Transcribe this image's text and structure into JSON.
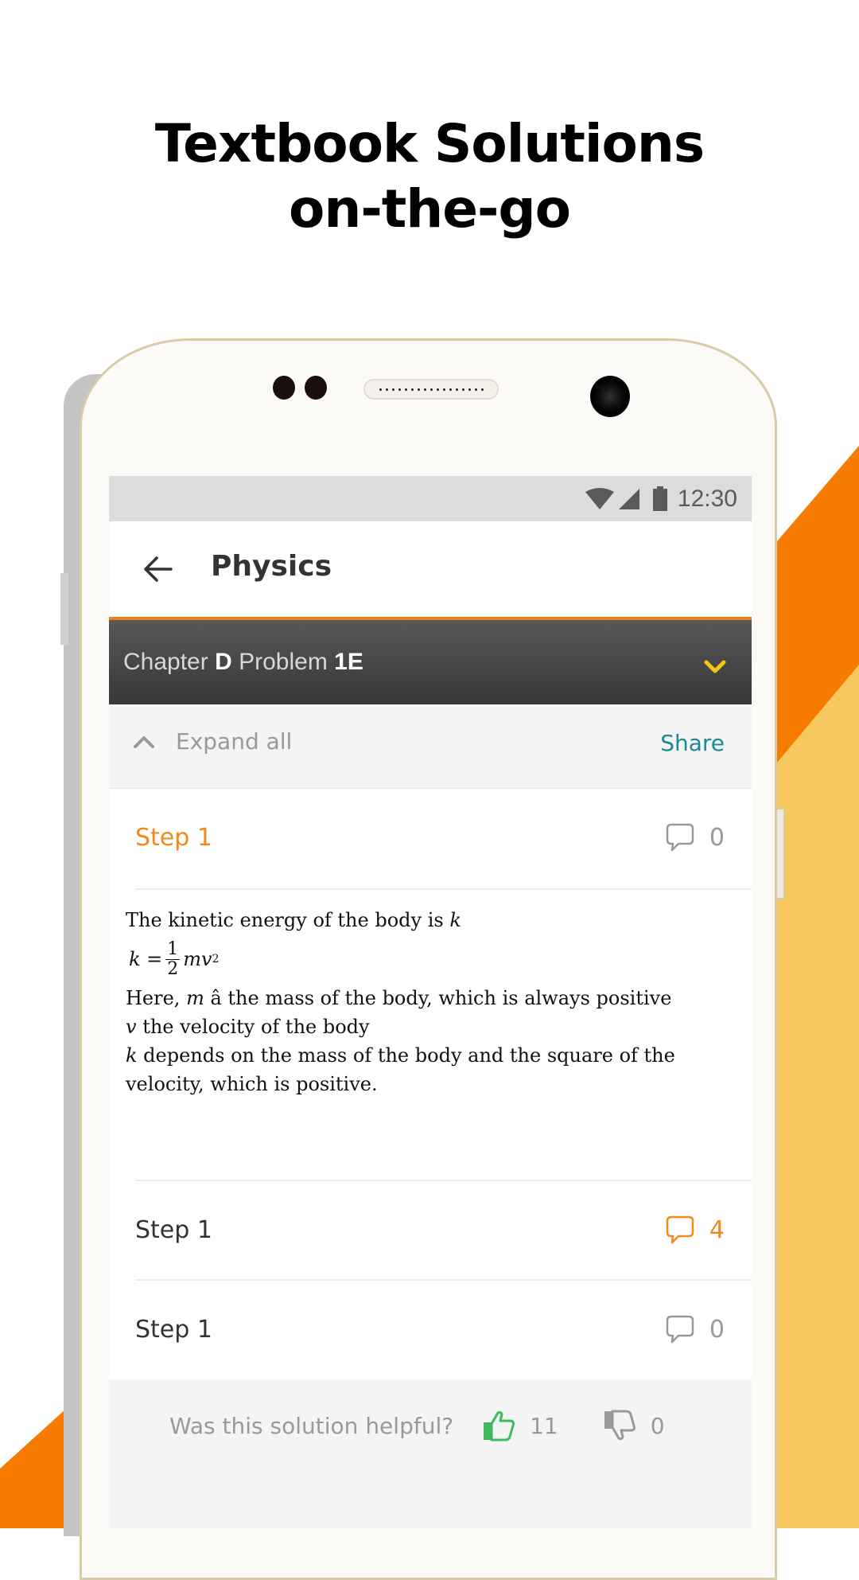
{
  "headline": {
    "line1": "Textbook Solutions",
    "line2": "on-the-go"
  },
  "colors": {
    "orange": "#f57c00",
    "yellow": "#f6c85f",
    "accent_orange": "#f08a1c",
    "teal": "#1b8a96",
    "green": "#3dba5c"
  },
  "status_bar": {
    "time": "12:30",
    "icons": [
      "wifi-icon",
      "signal-icon",
      "battery-icon"
    ]
  },
  "app_bar": {
    "title": "Physics",
    "back_icon": "arrow-left-icon"
  },
  "chapter_bar": {
    "chapter_label": "Chapter",
    "chapter_value": "D",
    "problem_label": "Problem",
    "problem_value": "1E",
    "dropdown_icon": "chevron-down-icon"
  },
  "toolbar": {
    "expand_label": "Expand all",
    "share_label": "Share"
  },
  "steps": [
    {
      "label": "Step 1",
      "comments": "0",
      "expanded": true
    },
    {
      "label": "Step 1",
      "comments": "4",
      "expanded": false
    },
    {
      "label": "Step 1",
      "comments": "0",
      "expanded": false
    }
  ],
  "step_content": {
    "line1": "The kinetic energy of the body is ",
    "line1_var": "k",
    "formula": {
      "lhs": "k =",
      "num": "1",
      "den": "2",
      "rhs": "mv",
      "exp": "2"
    },
    "line2_pre": "Here, ",
    "line2_var": "m",
    "line2_post": " â the mass of the body, which is always positive",
    "line3_var": "v",
    "line3_post": " the velocity of the body",
    "line4_var": "k",
    "line4_post": " depends on the mass of the body and the square of the velocity, which is positive."
  },
  "feedback": {
    "question": "Was this solution helpful?",
    "upvotes": "11",
    "downvotes": "0"
  }
}
